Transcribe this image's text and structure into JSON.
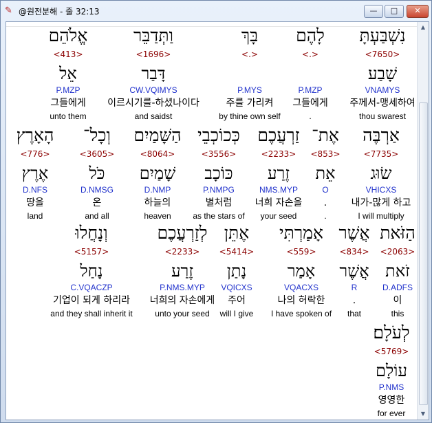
{
  "window": {
    "title": "@원전분해 - 줄 32:13",
    "buttons": {
      "minimize": "—",
      "maximize": "□",
      "close": "✕"
    }
  },
  "colors": {
    "number": "#8b0000",
    "parse": "#2233cc",
    "text": "#000000"
  },
  "rows": [
    [
      {
        "heb": "אֱלֹהֵם",
        "num": "<413>",
        "root": "אֵל",
        "parse": "P.MZP",
        "kor": "그들에게",
        "eng": "unto them"
      },
      {
        "heb": "וַתְּדַבֵּר",
        "num": "<1696>",
        "root": "דָּבַר",
        "parse": "CW.VQIMYS",
        "kor": "이르시기를-하셨나이다",
        "eng": "and saidst"
      },
      {
        "heb": "בָּךְ",
        "num": "<.>",
        "root": "",
        "parse": "P.MYS",
        "kor": "주를 가리켜",
        "eng": "by thine own self"
      },
      {
        "heb": "לָהֶם",
        "num": "<.>",
        "root": "",
        "parse": "P.MZP",
        "kor": "그들에게",
        "eng": "."
      },
      {
        "heb": "נִשְׁבַּעְתָּ",
        "num": "<7650>",
        "root": "שָׁבַע",
        "parse": "VNAMYS",
        "kor": "주께서-맹세하여",
        "eng": "thou swarest"
      }
    ],
    [
      {
        "heb": "הָאָרֶץ",
        "num": "<776>",
        "root": "אֶרֶץ",
        "parse": "D.NFS",
        "kor": "땅을",
        "eng": "land"
      },
      {
        "heb": "וְכָל־",
        "num": "<3605>",
        "root": "כֹּל",
        "parse": "D.NMSG",
        "kor": "온",
        "eng": "and all"
      },
      {
        "heb": "הַשָּׁמַיִם",
        "num": "<8064>",
        "root": "שָׁמַיִם",
        "parse": "D.NMP",
        "kor": "하늘의",
        "eng": "heaven"
      },
      {
        "heb": "כְּכוֹכְבֵי",
        "num": "<3556>",
        "root": "כּוֹכָב",
        "parse": "P.NMPG",
        "kor": "별처럼",
        "eng": "as the stars of"
      },
      {
        "heb": "זַרְעֲכֶם",
        "num": "<2233>",
        "root": "זֶרַע",
        "parse": "NMS.MYP",
        "kor": "너희 자손을",
        "eng": "your seed"
      },
      {
        "heb": "אֶת־",
        "num": "<853>",
        "root": "אֵת",
        "parse": "O",
        "kor": ".",
        "eng": "."
      },
      {
        "heb": "אַרְבֶּה",
        "num": "<7735>",
        "root": "שׂוּג",
        "parse": "VHICXS",
        "kor": "내가-많게 하고",
        "eng": "I will multiply"
      }
    ],
    [
      {
        "heb": "וְנָחֲלוּ",
        "num": "<5157>",
        "root": "נָחַל",
        "parse": "C.VQACZP",
        "kor": "기업이 되게 하리라",
        "eng": "and they shall inherit it"
      },
      {
        "heb": "לְזַרְעֲכֶם",
        "num": "<2233>",
        "root": "זֶרַע",
        "parse": "P.NMS.MYP",
        "kor": "너희의 자손에게",
        "eng": "unto your seed"
      },
      {
        "heb": "אֶתֵּן",
        "num": "<5414>",
        "root": "נָתַן",
        "parse": "VQICXS",
        "kor": "주어",
        "eng": "will I give"
      },
      {
        "heb": "אָמַרְתִּי",
        "num": "<559>",
        "root": "אָמַר",
        "parse": "VQACXS",
        "kor": "나의 허락한",
        "eng": "I have spoken of"
      },
      {
        "heb": "אֲשֶׁר",
        "num": "<834>",
        "root": "אֲשֶׁר",
        "parse": "R",
        "kor": ".",
        "eng": "that"
      },
      {
        "heb": "הַזֹּאת",
        "num": "<2063>",
        "root": "זֹאת",
        "parse": "D.ADFS",
        "kor": "이",
        "eng": "this"
      }
    ],
    [
      {
        "heb": "לְעֹלָם׃",
        "num": "<5769>",
        "root": "עוֹלָם",
        "parse": "P.NMS",
        "kor": "영영한",
        "eng": "for ever"
      }
    ]
  ]
}
